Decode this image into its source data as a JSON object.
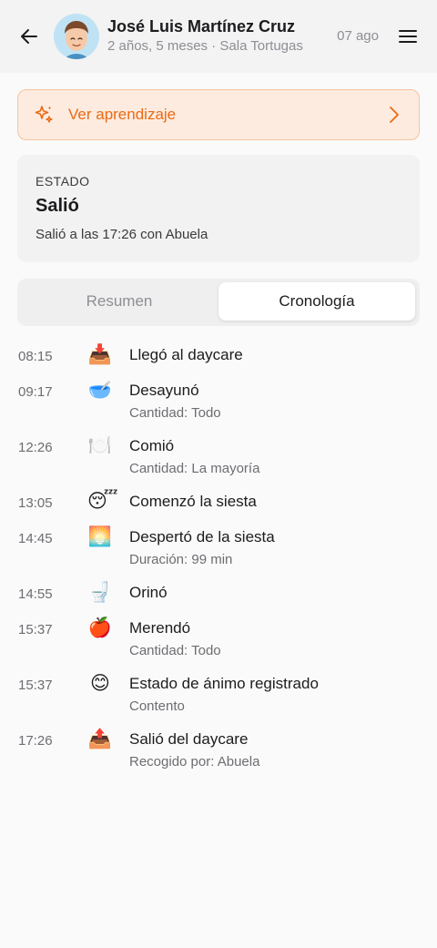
{
  "header": {
    "child_name": "José Luis Martínez Cruz",
    "child_subtitle": "2 años, 5 meses · Sala Tortugas",
    "date": "07 ago",
    "back_icon": "arrow-left-icon",
    "menu_icon": "hamburger-menu-icon"
  },
  "learning_banner": {
    "label": "Ver aprendizaje",
    "icon": "sparkles-icon",
    "accent_color": "#ea6a14"
  },
  "status": {
    "kicker": "ESTADO",
    "title": "Salió",
    "detail": "Salió a las 17:26 con Abuela"
  },
  "tabs": [
    {
      "label": "Resumen",
      "selected": false
    },
    {
      "label": "Cronología",
      "selected": true
    }
  ],
  "timeline": [
    {
      "time": "08:15",
      "icon": "📥",
      "icon_name": "inbox-tray-icon",
      "title": "Llegó al daycare",
      "detail": ""
    },
    {
      "time": "09:17",
      "icon": "🥣",
      "icon_name": "bowl-icon",
      "title": "Desayunó",
      "detail": "Cantidad: Todo"
    },
    {
      "time": "12:26",
      "icon": "🍽️",
      "icon_name": "plate-icon",
      "title": "Comió",
      "detail": "Cantidad: La mayoría"
    },
    {
      "time": "13:05",
      "icon": "😴",
      "icon_name": "sleeping-face-icon",
      "title": "Comenzó la siesta",
      "detail": ""
    },
    {
      "time": "14:45",
      "icon": "🌅",
      "icon_name": "sunrise-icon",
      "title": "Despertó de la siesta",
      "detail": "Duración: 99 min"
    },
    {
      "time": "14:55",
      "icon": "🚽",
      "icon_name": "toilet-icon",
      "title": "Orinó",
      "detail": ""
    },
    {
      "time": "15:37",
      "icon": "🍎",
      "icon_name": "apple-icon",
      "title": "Merendó",
      "detail": "Cantidad: Todo"
    },
    {
      "time": "15:37",
      "icon": "😊",
      "icon_name": "smiling-face-icon",
      "title": "Estado de ánimo registrado",
      "detail": "Contento"
    },
    {
      "time": "17:26",
      "icon": "📤",
      "icon_name": "outbox-tray-icon",
      "title": "Salió del daycare",
      "detail": "Recogido por: Abuela"
    }
  ]
}
